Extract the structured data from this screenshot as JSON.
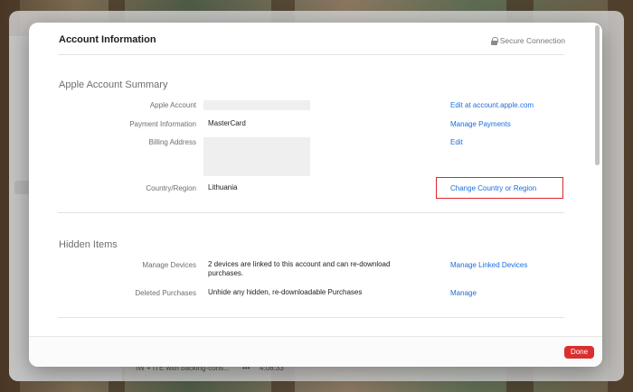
{
  "background_app": {
    "status_item": "IW + ITE with backing-cons...",
    "status_dots": "•••",
    "status_time": "4:08:33"
  },
  "sheet": {
    "title": "Account Information",
    "secure_connection": "Secure Connection",
    "summary": {
      "title": "Apple Account Summary",
      "rows": [
        {
          "label": "Apple Account",
          "value": "",
          "link": "Edit at account.apple.com"
        },
        {
          "label": "Payment Information",
          "value": "MasterCard",
          "link": "Manage Payments"
        },
        {
          "label": "Billing Address",
          "value": "",
          "link": "Edit"
        },
        {
          "label": "Country/Region",
          "value": "Lithuania",
          "link": "Change Country or Region"
        }
      ]
    },
    "hidden": {
      "title": "Hidden Items",
      "rows": [
        {
          "label": "Manage Devices",
          "value_line1": "2 devices are linked to this account and can re-download",
          "value_line2": "purchases.",
          "link": "Manage Linked Devices"
        },
        {
          "label": "Deleted Purchases",
          "value": "Unhide any hidden, re-downloadable Purchases",
          "link": "Manage"
        }
      ]
    },
    "done_label": "Done"
  },
  "colors": {
    "accent_link": "#1a6fe0",
    "done_button": "#d92f2f",
    "highlight_box": "#e0252b"
  }
}
